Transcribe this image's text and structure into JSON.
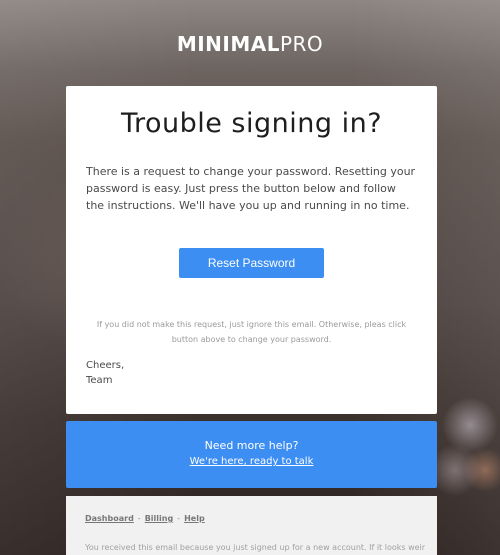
{
  "logo": {
    "bold": "MINIMAL",
    "light": "PRO"
  },
  "card": {
    "title": "Trouble signing in?",
    "intro": "There is a request to change your password. Resetting your password is easy. Just press the button below and follow the instructions. We'll have you up and running in no time.",
    "button_label": "Reset Password",
    "note": "If you did not make this request, just ignore this email. Otherwise, pleas click button above to change your password.",
    "signoff_line1": "Cheers,",
    "signoff_line2": "Team"
  },
  "help": {
    "title": "Need more help?",
    "link": "We're here, ready to talk"
  },
  "footer": {
    "links": [
      "Dashboard",
      "Billing",
      "Help"
    ],
    "separator": "-",
    "text": "You received this email because you just signed up for a new account. If it looks weird,"
  },
  "colors": {
    "accent": "#3d8ef2",
    "card_bg": "#ffffff",
    "footer_bg": "#f1f1f1"
  }
}
